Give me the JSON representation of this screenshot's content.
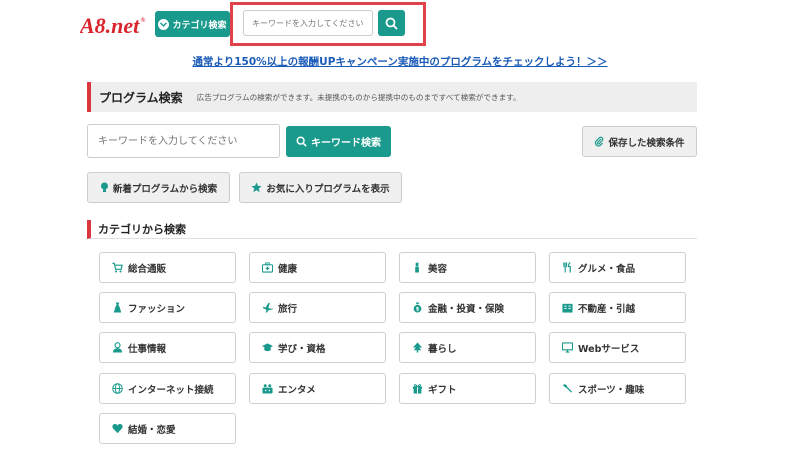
{
  "header": {
    "logo_text": "A8.net",
    "logo_mark": "®",
    "category_button": "カテゴリ検索",
    "search_placeholder": "キーワードを入力してください"
  },
  "campaign_link": "通常より150%以上の報酬UPキャンペーン実施中のプログラムをチェックしよう！＞＞",
  "program_search": {
    "title": "プログラム検索",
    "description": "広告プログラムの検索ができます。未提携のものから提携中のものまですべて検索ができます。",
    "keyword_placeholder": "キーワードを入力してください",
    "keyword_button": "キーワード検索",
    "saved_button": "保存した検索条件",
    "new_button": "新着プログラムから検索",
    "favorite_button": "お気に入りプログラムを表示"
  },
  "category_search": {
    "title": "カテゴリから検索",
    "items": [
      {
        "label": "総合通販",
        "icon": "cart-icon"
      },
      {
        "label": "健康",
        "icon": "first-aid-icon"
      },
      {
        "label": "美容",
        "icon": "lipstick-icon"
      },
      {
        "label": "グルメ・食品",
        "icon": "utensils-icon"
      },
      {
        "label": "ファッション",
        "icon": "dress-icon"
      },
      {
        "label": "旅行",
        "icon": "plane-icon"
      },
      {
        "label": "金融・投資・保険",
        "icon": "money-bag-icon"
      },
      {
        "label": "不動産・引越",
        "icon": "building-icon"
      },
      {
        "label": "仕事情報",
        "icon": "person-icon"
      },
      {
        "label": "学び・資格",
        "icon": "grad-cap-icon"
      },
      {
        "label": "暮らし",
        "icon": "house-tree-icon"
      },
      {
        "label": "Webサービス",
        "icon": "monitor-icon"
      },
      {
        "label": "インターネット接続",
        "icon": "globe-icon"
      },
      {
        "label": "エンタメ",
        "icon": "game-icon"
      },
      {
        "label": "ギフト",
        "icon": "gift-icon"
      },
      {
        "label": "スポーツ・趣味",
        "icon": "wrench-icon"
      },
      {
        "label": "結婚・恋愛",
        "icon": "heart-icon"
      }
    ]
  },
  "colors": {
    "accent": "#1a9a8c",
    "brand_red": "#d9363e",
    "highlight": "#e0424b",
    "link": "#1a5bb8"
  }
}
